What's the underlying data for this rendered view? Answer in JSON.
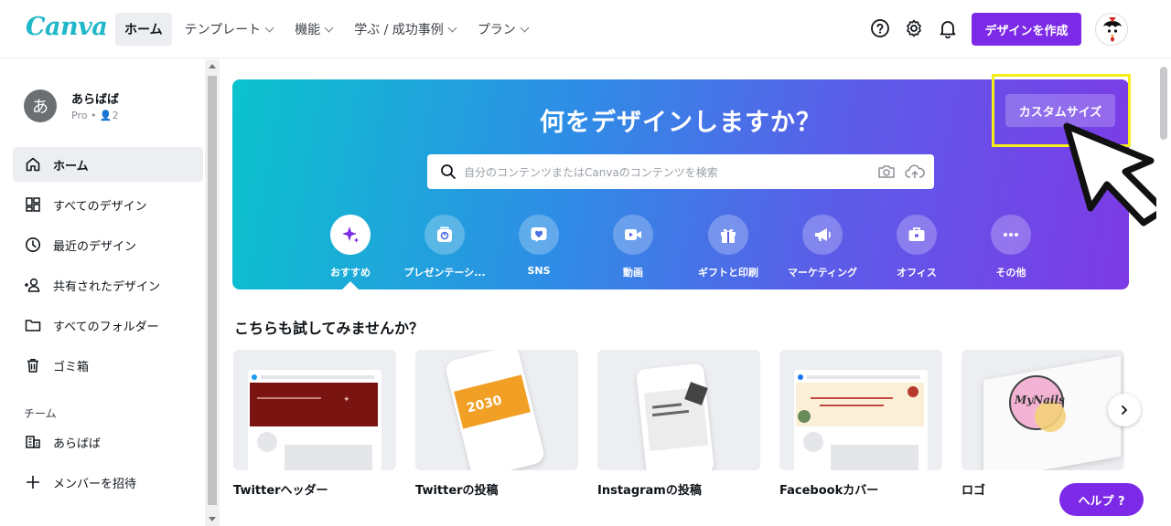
{
  "app": {
    "logo": "Canva"
  },
  "nav": [
    {
      "label": "ホーム",
      "active": true,
      "dropdown": false
    },
    {
      "label": "テンプレート",
      "dropdown": true
    },
    {
      "label": "機能",
      "dropdown": true
    },
    {
      "label": "学ぶ / 成功事例",
      "dropdown": true
    },
    {
      "label": "プラン",
      "dropdown": true
    }
  ],
  "header": {
    "create_label": "デザインを作成",
    "icons": [
      "help-icon",
      "settings-icon",
      "bell-icon"
    ],
    "accent": "#7d2ae8"
  },
  "profile": {
    "initial": "あ",
    "name": "あらばば",
    "meta": "Pro • 👤2"
  },
  "sidebar": {
    "items": [
      {
        "label": "ホーム",
        "icon": "home-icon",
        "active": true
      },
      {
        "label": "すべてのデザイン",
        "icon": "grid-icon"
      },
      {
        "label": "最近のデザイン",
        "icon": "clock-icon"
      },
      {
        "label": "共有されたデザイン",
        "icon": "people-icon"
      },
      {
        "label": "すべてのフォルダー",
        "icon": "folder-icon"
      },
      {
        "label": "ゴミ箱",
        "icon": "trash-icon"
      }
    ],
    "team_heading": "チーム",
    "team_items": [
      {
        "label": "あらばば",
        "icon": "building-icon"
      },
      {
        "label": "メンバーを招待",
        "icon": "plus-icon"
      }
    ]
  },
  "hero": {
    "title": "何をデザインしますか？",
    "search_placeholder": "自分のコンテンツまたはCanvaのコンテンツを検索",
    "custom_size_label": "カスタムサイズ",
    "categories": [
      {
        "label": "おすすめ",
        "icon": "sparkle-icon",
        "active": true
      },
      {
        "label": "プレゼンテーシ...",
        "icon": "presentation-icon"
      },
      {
        "label": "SNS",
        "icon": "heart-icon"
      },
      {
        "label": "動画",
        "icon": "video-icon"
      },
      {
        "label": "ギフトと印刷",
        "icon": "gift-icon"
      },
      {
        "label": "マーケティング",
        "icon": "megaphone-icon"
      },
      {
        "label": "オフィス",
        "icon": "briefcase-icon"
      },
      {
        "label": "その他",
        "icon": "more-icon"
      }
    ]
  },
  "suggestions": {
    "title": "こちらも試してみませんか？",
    "cards": [
      {
        "label": "Twitterヘッダー"
      },
      {
        "label": "Twitterの投稿"
      },
      {
        "label": "Instagramの投稿"
      },
      {
        "label": "Facebookカバー"
      },
      {
        "label": "ロゴ"
      }
    ]
  },
  "help": {
    "label": "ヘルプ ?"
  }
}
